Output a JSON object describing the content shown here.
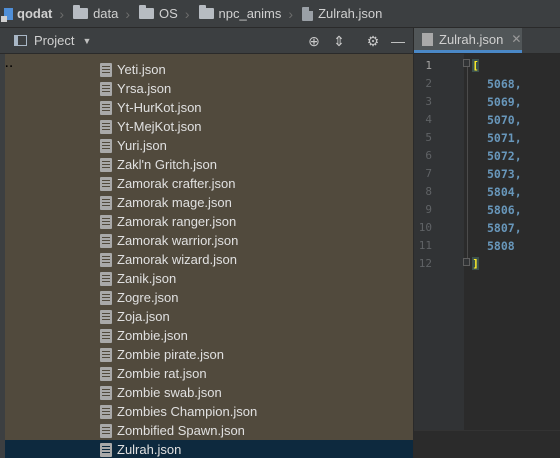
{
  "breadcrumb": [
    {
      "label": "qodat",
      "type": "root"
    },
    {
      "label": "data",
      "type": "folder"
    },
    {
      "label": "OS",
      "type": "folder"
    },
    {
      "label": "npc_anims",
      "type": "folder"
    },
    {
      "label": "Zulrah.json",
      "type": "file"
    }
  ],
  "project_panel": {
    "title": "Project",
    "icons": [
      "crosshair-icon",
      "collapse-icon",
      "gear-icon",
      "minimize-icon"
    ]
  },
  "tree": {
    "partial_item": "...",
    "items": [
      "Yeti.json",
      "Yrsa.json",
      "Yt-HurKot.json",
      "Yt-MejKot.json",
      "Yuri.json",
      "Zakl'n Gritch.json",
      "Zamorak crafter.json",
      "Zamorak mage.json",
      "Zamorak ranger.json",
      "Zamorak warrior.json",
      "Zamorak wizard.json",
      "Zanik.json",
      "Zogre.json",
      "Zoja.json",
      "Zombie.json",
      "Zombie pirate.json",
      "Zombie rat.json",
      "Zombie swab.json",
      "Zombies Champion.json",
      "Zombified Spawn.json",
      "Zulrah.json"
    ],
    "selected": "Zulrah.json"
  },
  "editor": {
    "tab_label": "Zulrah.json",
    "line_numbers": [
      "1",
      "2",
      "3",
      "4",
      "5",
      "6",
      "7",
      "8",
      "9",
      "10",
      "11",
      "12"
    ],
    "open_bracket": "[",
    "close_bracket": "]",
    "values": [
      "5068,",
      "5069,",
      "5070,",
      "5071,",
      "5072,",
      "5073,",
      "5804,",
      "5806,",
      "5807,",
      "5808"
    ]
  }
}
